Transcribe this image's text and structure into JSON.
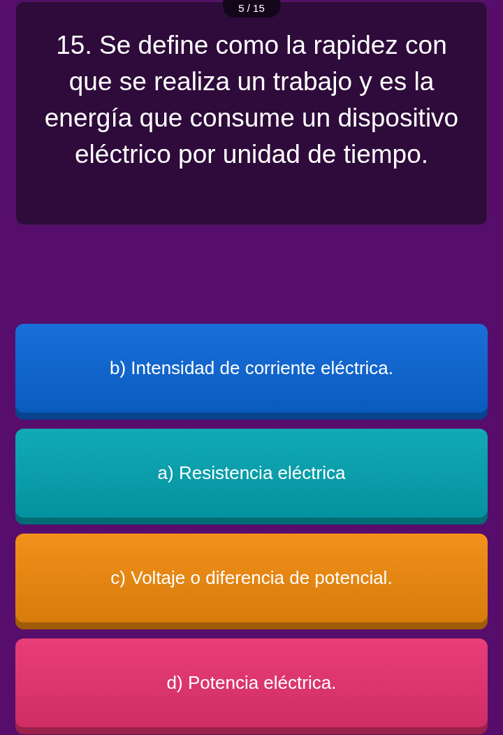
{
  "counter": "5 / 15",
  "question": "15. Se define como la rapidez con que se realiza un trabajo y es la energía que consume un dispositivo eléctrico por unidad de tiempo.",
  "options": [
    {
      "text": "b) Intensidad de corriente eléctrica.",
      "color": "#0b66d6"
    },
    {
      "text": "a) Resistencia eléctrica",
      "color": "#03a4b2"
    },
    {
      "text": "c) Voltaje o diferencia de potencial.",
      "color": "#f28a0c"
    },
    {
      "text": "d) Potencia eléctrica.",
      "color": "#e83270"
    }
  ]
}
